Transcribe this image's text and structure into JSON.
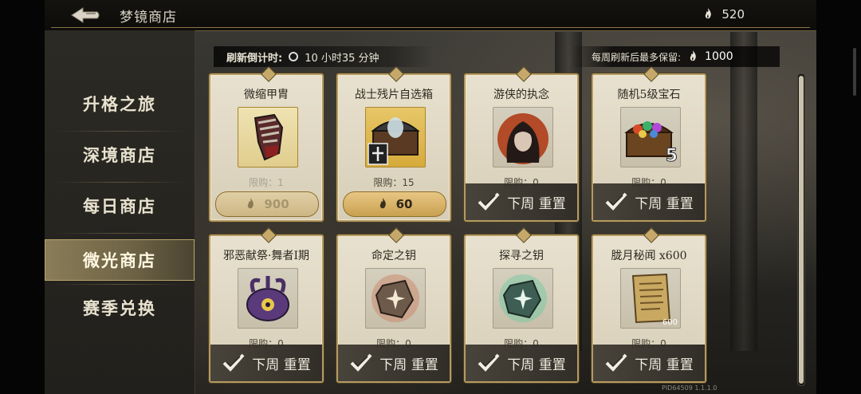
{
  "header": {
    "title": "梦镜商店",
    "currency_amount": "520"
  },
  "sidebar": {
    "items": [
      {
        "label": "升格之旅"
      },
      {
        "label": "深境商店"
      },
      {
        "label": "每日商店"
      },
      {
        "label": "微光商店"
      },
      {
        "label": "赛季兑换"
      }
    ],
    "active_index": 3
  },
  "refresh": {
    "label": "刷新倒计时:",
    "time": "10 小时35 分钟"
  },
  "retain": {
    "label": "每周刷新后最多保留:",
    "value": "1000"
  },
  "cards": [
    {
      "name": "微缩甲胄",
      "limit": "限购：1",
      "price": "900",
      "state": "price-dim",
      "icon": "armor-gauntlet-icon"
    },
    {
      "name": "战士残片自选箱",
      "limit": "限购：15",
      "price": "60",
      "state": "price",
      "icon": "warrior-chest-icon"
    },
    {
      "name": "游侠的执念",
      "limit": "限购：0",
      "reset": "下周 重置",
      "state": "reset",
      "icon": "ranger-portrait-icon"
    },
    {
      "name": "随机5级宝石",
      "limit": "限购：0",
      "reset": "下周 重置",
      "state": "reset",
      "icon": "gem-chest-icon",
      "badge": "5"
    },
    {
      "name": "邪恶献祭·舞者I期",
      "limit": "限购：0",
      "reset": "下周 重置",
      "state": "reset",
      "icon": "dark-relic-icon"
    },
    {
      "name": "命定之钥",
      "limit": "限购：0",
      "reset": "下周 重置",
      "state": "reset",
      "icon": "fate-key-stone-icon"
    },
    {
      "name": "探寻之钥",
      "limit": "限购：0",
      "reset": "下周 重置",
      "state": "reset",
      "icon": "seek-key-stone-icon"
    },
    {
      "name": "胧月秘闻 x600",
      "limit": "限购：0",
      "reset": "下周 重置",
      "state": "reset",
      "icon": "scroll-icon",
      "badge": "600"
    }
  ],
  "footer": {
    "build": "PID64509  1.1.1.0"
  },
  "colors": {
    "accent_gold": "#c9a050",
    "card_bg": "#e3dcc8",
    "header_bg": "#0d0c0a"
  }
}
